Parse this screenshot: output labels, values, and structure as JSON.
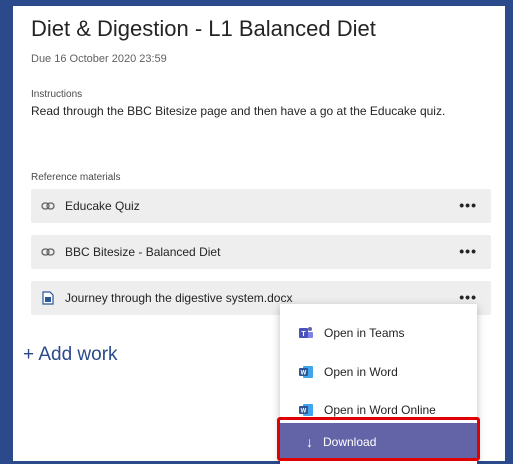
{
  "assignment": {
    "title": "Diet & Digestion - L1 Balanced Diet",
    "due": "Due 16 October 2020 23:59",
    "instructions_label": "Instructions",
    "instructions_text": "Read through the BBC Bitesize page and then have a go at the Educake quiz.",
    "reference_label": "Reference materials"
  },
  "references": [
    {
      "label": "Educake Quiz",
      "icon": "link-icon",
      "more": "•••"
    },
    {
      "label": "BBC Bitesize - Balanced Diet",
      "icon": "link-icon",
      "more": "•••"
    },
    {
      "label": "Journey through the digestive system.docx",
      "icon": "word-doc-icon",
      "more": "•••"
    }
  ],
  "add_work": "+ Add work",
  "context_menu": {
    "items": [
      {
        "label": "Open in Teams",
        "icon": "teams-icon"
      },
      {
        "label": "Open in Word",
        "icon": "word-icon"
      },
      {
        "label": "Open in Word Online",
        "icon": "word-icon"
      }
    ],
    "download": {
      "label": "Download",
      "icon": "download-icon"
    }
  },
  "colors": {
    "background": "#2b4a8c",
    "teams_purple": "#6264a7",
    "word_blue": "#2b5797",
    "highlight_red": "#e00000"
  }
}
